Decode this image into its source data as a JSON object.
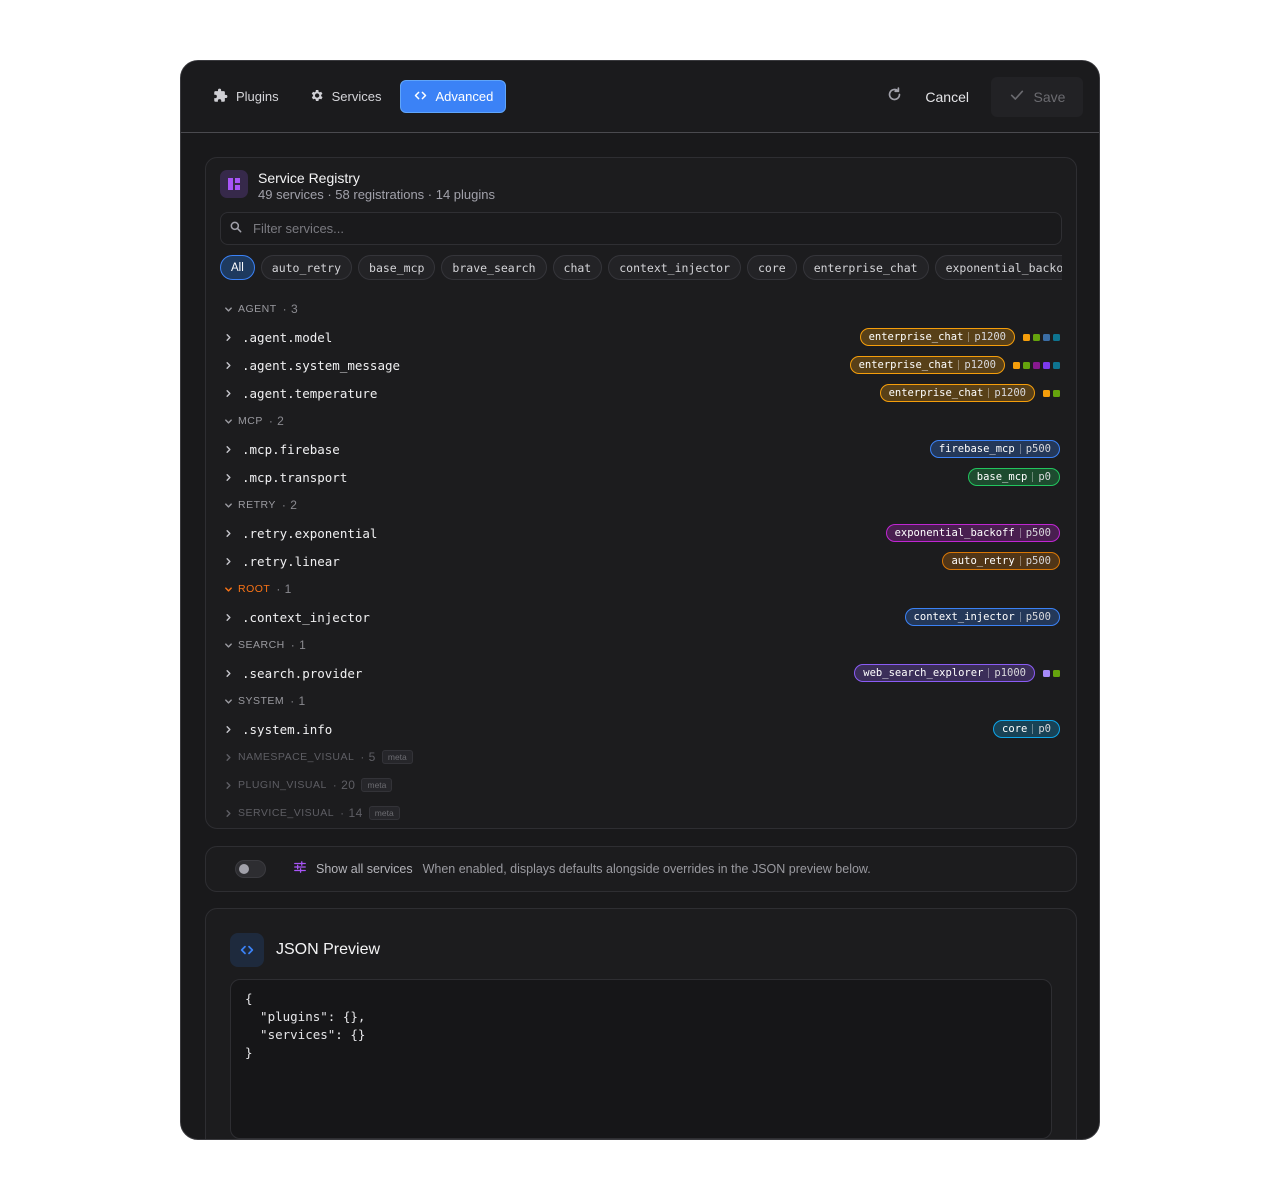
{
  "tabs": [
    {
      "label": "Plugins"
    },
    {
      "label": "Services"
    },
    {
      "label": "Advanced"
    }
  ],
  "actions": {
    "cancel": "Cancel",
    "save": "Save"
  },
  "registry": {
    "title": "Service Registry",
    "subtitle": "49 services · 58 registrations · 14 plugins",
    "filter_placeholder": "Filter services...",
    "chips": [
      "All",
      "auto_retry",
      "base_mcp",
      "brave_search",
      "chat",
      "context_injector",
      "core",
      "enterprise_chat",
      "exponential_backoff"
    ],
    "groups": [
      {
        "name": "AGENT",
        "count": "3",
        "items": [
          {
            "name": ".agent.model",
            "plugin": "enterprise_chat",
            "priority": "p1200",
            "color": "#f59e0b",
            "dots": [
              "#f59e0b",
              "#65a30d",
              "#3b6ea5",
              "#0e7490"
            ]
          },
          {
            "name": ".agent.system_message",
            "plugin": "enterprise_chat",
            "priority": "p1200",
            "color": "#f59e0b",
            "dots": [
              "#f59e0b",
              "#65a30d",
              "#86198f",
              "#7c3aed",
              "#0e7490"
            ]
          },
          {
            "name": ".agent.temperature",
            "plugin": "enterprise_chat",
            "priority": "p1200",
            "color": "#f59e0b",
            "dots": [
              "#f59e0b",
              "#65a30d"
            ]
          }
        ]
      },
      {
        "name": "MCP",
        "count": "2",
        "items": [
          {
            "name": ".mcp.firebase",
            "plugin": "firebase_mcp",
            "priority": "p500",
            "color": "#3b82f6",
            "dots": []
          },
          {
            "name": ".mcp.transport",
            "plugin": "base_mcp",
            "priority": "p0",
            "color": "#22c55e",
            "dots": []
          }
        ]
      },
      {
        "name": "RETRY",
        "count": "2",
        "items": [
          {
            "name": ".retry.exponential",
            "plugin": "exponential_backoff",
            "priority": "p500",
            "color": "#c026d3",
            "dots": []
          },
          {
            "name": ".retry.linear",
            "plugin": "auto_retry",
            "priority": "p500",
            "color": "#d97706",
            "dots": []
          }
        ]
      },
      {
        "name": "ROOT",
        "count": "1",
        "items": [
          {
            "name": ".context_injector",
            "plugin": "context_injector",
            "priority": "p500",
            "color": "#3b82f6",
            "dots": []
          }
        ]
      },
      {
        "name": "SEARCH",
        "count": "1",
        "items": [
          {
            "name": ".search.provider",
            "plugin": "web_search_explorer",
            "priority": "p1000",
            "color": "#8b5cf6",
            "dots": [
              "#a78bfa",
              "#65a30d"
            ]
          }
        ]
      },
      {
        "name": "SYSTEM",
        "count": "1",
        "items": [
          {
            "name": ".system.info",
            "plugin": "core",
            "priority": "p0",
            "color": "#0ea5e9",
            "dots": []
          }
        ]
      }
    ],
    "meta_groups": [
      {
        "name": "NAMESPACE_VISUAL",
        "count": "5",
        "tag": "meta"
      },
      {
        "name": "PLUGIN_VISUAL",
        "count": "20",
        "tag": "meta"
      },
      {
        "name": "SERVICE_VISUAL",
        "count": "14",
        "tag": "meta"
      }
    ]
  },
  "toggle": {
    "label": "Show all services",
    "description": "When enabled, displays defaults alongside overrides in the JSON preview below.",
    "enabled": false
  },
  "json_preview": {
    "title": "JSON Preview",
    "code": "{\n  \"plugins\": {},\n  \"services\": {}\n}"
  }
}
